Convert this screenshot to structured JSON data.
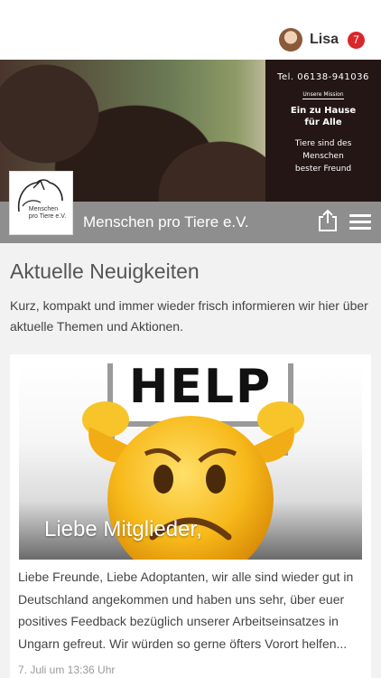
{
  "header": {
    "user_name": "Lisa",
    "notification_count": "7"
  },
  "banner": {
    "phone": "Tel. 06138-941036",
    "mission_label": "Unsere Mission",
    "slogan": "Ein zu Hause für Alle",
    "tagline": "Tiere sind des Menschen bester Freund",
    "logo_text_line1": "Menschen",
    "logo_text_line2": "pro Tiere e.V."
  },
  "titlebar": {
    "org_name": "Menschen pro Tiere e.V."
  },
  "main": {
    "page_title": "Aktuelle Neuigkeiten",
    "intro": "Kurz, kompakt und immer wieder frisch informieren wir hier über aktuelle Themen und Aktionen."
  },
  "news": [
    {
      "image_sign_text": "HELP",
      "caption": "Liebe Mitglieder,",
      "excerpt": "Liebe Freunde, Liebe Adoptanten, wir alle sind wieder gut in Deutschland angekommen und haben uns sehr, über euer positives Feedback bezüglich unserer Arbeitseinsatzes in Ungarn gefreut. Wir würden so gerne öfters Vorort helfen...",
      "date": "7. Juli um 13:36 Uhr"
    }
  ],
  "colors": {
    "accent_badge": "#d9262b",
    "titlebar_bg": "#8e8e8e",
    "page_bg": "#f2f2f2"
  }
}
